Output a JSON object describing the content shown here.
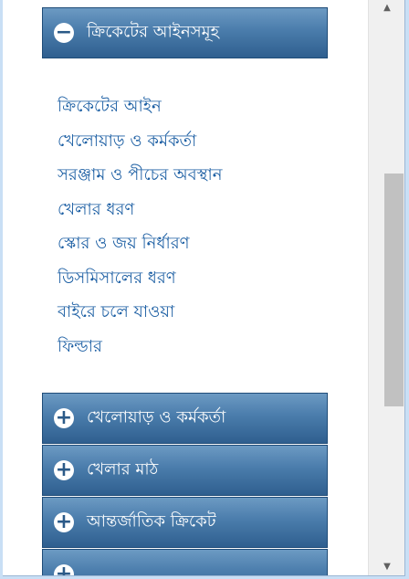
{
  "open_section": {
    "label": "ক্রিকেটের আইনসমূহ",
    "toggle": "−",
    "links": [
      "ক্রিকেটের আইন",
      "খেলোয়াড় ও কর্মকর্তা",
      "সরঞ্জাম ও পীচের অবস্থান",
      "খেলার ধরণ",
      "স্কোর ও জয় নির্ধারণ",
      "ডিসমিসালের ধরণ",
      "বাইরে চলে যাওয়া",
      "ফিল্ডার"
    ]
  },
  "collapsed_sections": [
    {
      "label": "খেলোয়াড় ও কর্মকর্তা",
      "toggle": "+"
    },
    {
      "label": "খেলার মাঠ",
      "toggle": "+"
    },
    {
      "label": "আন্তর্জাতিক ক্রিকেট",
      "toggle": "+"
    },
    {
      "label": "",
      "toggle": "+"
    }
  ],
  "scrollbar": {
    "up_arrow": "▲",
    "down_arrow": "▼"
  }
}
